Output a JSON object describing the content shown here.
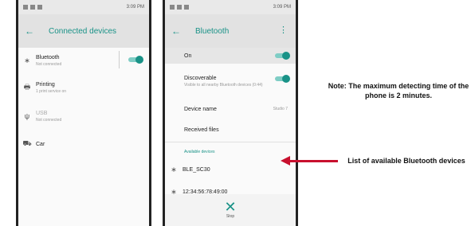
{
  "left_phone": {
    "status": {
      "time": "3:09 PM"
    },
    "appbar": {
      "back": "←",
      "title": "Connected devices"
    },
    "items": [
      {
        "icon": "∗",
        "label": "Bluetooth",
        "sub": "Not connected"
      },
      {
        "icon": "🖶",
        "label": "Printing",
        "sub": "1 print service on"
      },
      {
        "icon": "ψ",
        "label": "USB",
        "sub": "Not connected"
      },
      {
        "icon": "⛟",
        "label": "Car",
        "sub": ""
      }
    ]
  },
  "right_phone": {
    "status": {
      "time": "3:09 PM"
    },
    "appbar": {
      "back": "←",
      "title": "Bluetooth",
      "menu": "⋮"
    },
    "on_label": "On",
    "discoverable": {
      "label": "Discoverable",
      "sub": "Visible to all nearby Bluetooth devices (0:44)"
    },
    "device_name": {
      "label": "Device name",
      "value": "Studio 7"
    },
    "received_files": "Received files",
    "available_header": "Available devices",
    "devices": [
      {
        "icon": "∗",
        "label": "BLE_SC30"
      },
      {
        "icon": "∗",
        "label": "12:34:56:78:49:00"
      }
    ],
    "stop": {
      "icon": "✕",
      "label": "Stop"
    }
  },
  "notes": {
    "note1": "Note: The maximum detecting time of the phone is 2 minutes.",
    "note2": "List of available Bluetooth devices"
  },
  "colors": {
    "accent": "#199287",
    "arrow": "#c8102e"
  }
}
